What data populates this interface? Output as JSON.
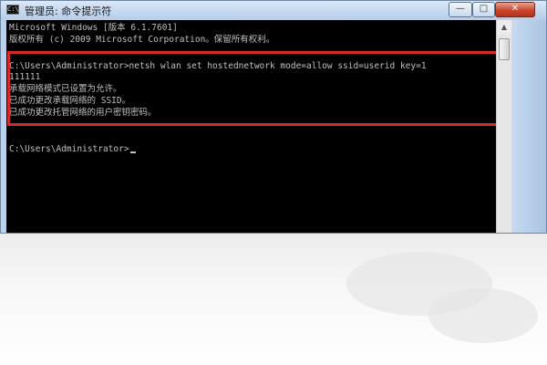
{
  "window": {
    "title": "管理员: 命令提示符",
    "icon_text": "C:\\",
    "buttons": {
      "minimize": "—",
      "maximize": "□",
      "close": "✕"
    }
  },
  "console": {
    "lines": [
      "Microsoft Windows [版本 6.1.7601]",
      "版权所有 (c) 2009 Microsoft Corporation。保留所有权利。",
      "C:\\Users\\Administrator>netsh wlan set hostednetwork mode=allow ssid=userid key=1",
      "111111",
      "承载网络模式已设置为允许。",
      "已成功更改承载网络的 SSID。",
      "已成功更改托管网络的用户密钥密码。",
      "C:\\Users\\Administrator>"
    ]
  },
  "colors": {
    "console_text": "#c0c0c0",
    "console_bg": "#000000",
    "highlight": "#d62a2a"
  },
  "icons": {
    "scroll_up": "▲"
  }
}
